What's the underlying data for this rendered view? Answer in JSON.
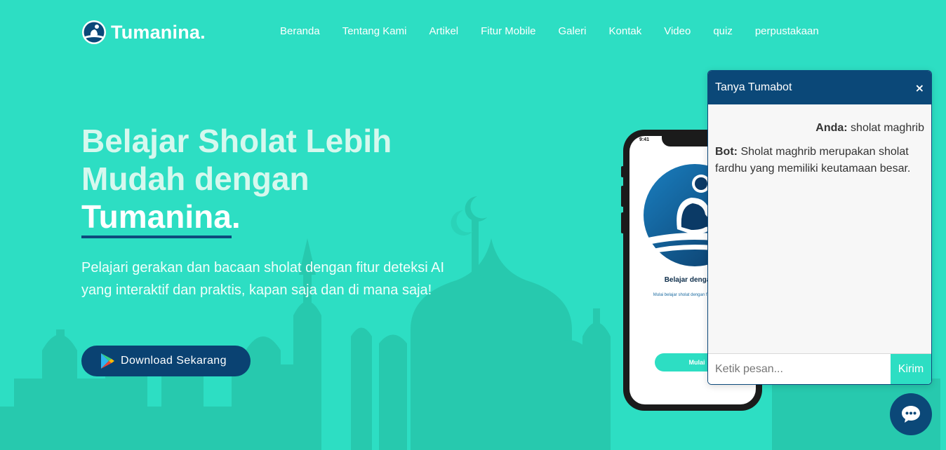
{
  "brand": {
    "name": "Tumanina",
    "dot": "."
  },
  "nav": {
    "items": [
      {
        "label": "Beranda"
      },
      {
        "label": "Tentang Kami"
      },
      {
        "label": "Artikel"
      },
      {
        "label": "Fitur Mobile"
      },
      {
        "label": "Galeri"
      },
      {
        "label": "Kontak"
      },
      {
        "label": "Video"
      },
      {
        "label": "quiz"
      },
      {
        "label": "perpustakaan"
      }
    ]
  },
  "hero": {
    "title_line1": "Belajar Sholat Lebih",
    "title_line2": "Mudah dengan",
    "title_brand": "Tumanina",
    "title_dot": ".",
    "subtitle": "Pelajari gerakan dan bacaan sholat dengan fitur deteksi AI yang interaktif dan praktis, kapan saja dan di mana saja!",
    "download_label": "Download Sekarang"
  },
  "phone": {
    "time": "9:41",
    "app_title": "Belajar dengan T",
    "app_desc": "Mulai belajar sholat dengan f dilengkapi AI",
    "app_button": "Mulai"
  },
  "chat": {
    "title": "Tanya Tumabot",
    "close_label": "×",
    "messages": [
      {
        "who": "Anda:",
        "text": "sholat maghrib"
      },
      {
        "who": "Bot:",
        "text": "Sholat maghrib merupakan sholat fardhu yang memiliki keutamaan besar."
      }
    ],
    "input_placeholder": "Ketik pesan...",
    "send_label": "Kirim"
  },
  "colors": {
    "background": "#2ddec3",
    "primary": "#0b4878",
    "silhouette": "#27cbb0"
  }
}
